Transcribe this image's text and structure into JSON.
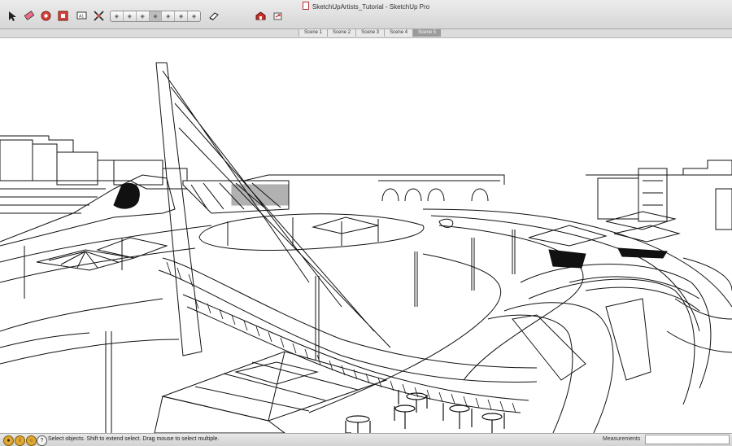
{
  "window": {
    "title": "SketchUpArtists_Tutorial - SketchUp Pro"
  },
  "toolbar": {
    "tools": [
      {
        "name": "select-tool",
        "icon": "arrow-cursor-icon"
      },
      {
        "name": "eraser-tool",
        "icon": "eraser-icon"
      },
      {
        "name": "orbit-tool",
        "icon": "orbit-icon"
      },
      {
        "name": "zoom-window-tool",
        "icon": "zoom-window-icon"
      },
      {
        "name": "text-tool",
        "icon": "text-icon",
        "label": "A1"
      },
      {
        "name": "zoom-extents-tool",
        "icon": "zoom-extents-icon"
      }
    ],
    "views": [
      "iso",
      "top",
      "front",
      "right",
      "back",
      "left",
      "bottom"
    ],
    "active_view": 3,
    "extra_tools": [
      {
        "name": "section-plane-tool",
        "icon": "section-icon"
      },
      {
        "name": "warehouse-tool",
        "icon": "warehouse-icon"
      },
      {
        "name": "share-model-tool",
        "icon": "share-icon"
      }
    ]
  },
  "scenes": {
    "tabs": [
      "Scene 1",
      "Scene 2",
      "Scene 3",
      "Scene 4",
      "Scene 5"
    ],
    "active": 4
  },
  "statusbar": {
    "message": "Select objects. Shift to extend select. Drag mouse to select multiple.",
    "measurements_label": "Measurements",
    "measurements_value": ""
  },
  "colors": {
    "accent": "#c0392b",
    "titlebar": "#dcdcdc",
    "active_tab": "#9b9b9b"
  }
}
